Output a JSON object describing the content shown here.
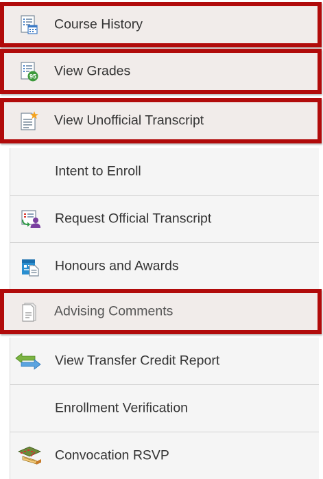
{
  "menu": {
    "items": [
      {
        "label": "Course History",
        "icon": "course-history-icon",
        "highlighted": true
      },
      {
        "label": "View Grades",
        "icon": "grades-icon",
        "highlighted": true
      },
      {
        "label": "View Unofficial Transcript",
        "icon": "unofficial-transcript-icon",
        "highlighted": true
      },
      {
        "label": "Intent to Enroll",
        "icon": "",
        "highlighted": false
      },
      {
        "label": "Request Official Transcript",
        "icon": "request-transcript-icon",
        "highlighted": false
      },
      {
        "label": "Honours and Awards",
        "icon": "honours-awards-icon",
        "highlighted": false
      },
      {
        "label": "Advising Comments",
        "icon": "advising-comments-icon",
        "highlighted": true
      },
      {
        "label": "View Transfer Credit Report",
        "icon": "transfer-arrows-icon",
        "highlighted": false
      },
      {
        "label": "Enrollment Verification",
        "icon": "",
        "highlighted": false
      },
      {
        "label": "Convocation RSVP",
        "icon": "convocation-icon",
        "highlighted": false
      }
    ],
    "grade_badge": "95"
  },
  "colors": {
    "highlight_border": "#b10b0b",
    "highlight_bg": "#f1ecea",
    "item_bg": "#f5f5f5",
    "divider": "#d2d2d2",
    "text": "#333333"
  }
}
